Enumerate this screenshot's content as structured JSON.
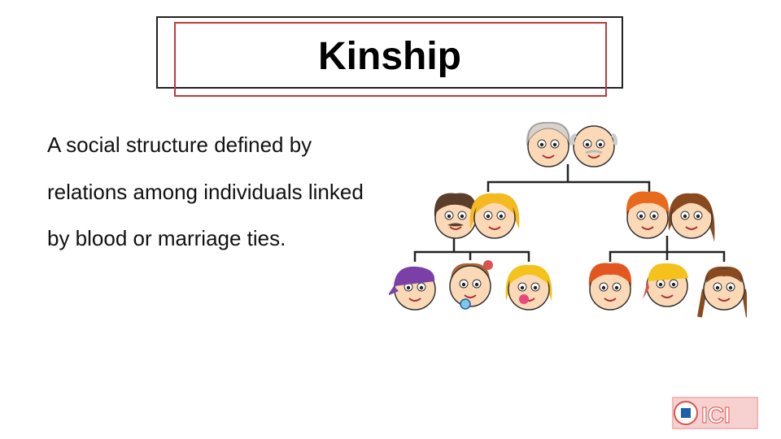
{
  "slide": {
    "title": "Kinship",
    "body": "A social structure defined by relations among individuals linked by blood or marriage ties."
  },
  "illustration": {
    "subject": "family-tree",
    "generations": [
      [
        "grandmother",
        "grandfather"
      ],
      [
        "father",
        "mother",
        "son",
        "daughter-in-law"
      ],
      [
        "boy",
        "baby-girl",
        "girl",
        "boy",
        "boy",
        "girl"
      ]
    ]
  },
  "logo": {
    "text": "ICI",
    "colors": {
      "red": "#d9534f",
      "pink": "#f2b8b8",
      "blue": "#1f5fa8"
    }
  },
  "colors": {
    "title_frame_outer": "#222222",
    "title_frame_inner": "#c0393b",
    "text": "#111111"
  }
}
